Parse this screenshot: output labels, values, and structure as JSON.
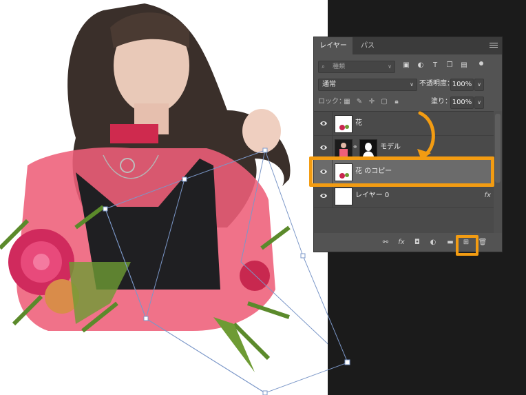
{
  "panel": {
    "tabs": [
      {
        "label": "レイヤー",
        "active": true
      },
      {
        "label": "パス",
        "active": false
      }
    ],
    "menu_icon": "hamburger-icon",
    "filter": {
      "placeholder": "種類",
      "icons": [
        "pixel-filter-icon",
        "adjustment-filter-icon",
        "type-filter-icon",
        "shape-filter-icon",
        "smart-object-filter-icon"
      ]
    },
    "blend_mode": "通常",
    "opacity_label": "不透明度：",
    "opacity_value": "100%",
    "lock_label": "ロック：",
    "lock_icons": [
      "lock-transparent-icon",
      "lock-paint-icon",
      "lock-move-icon",
      "lock-artboard-icon",
      "lock-all-icon"
    ],
    "fill_label": "塗り：",
    "fill_value": "100%",
    "layers": [
      {
        "name": "花",
        "visible": true,
        "selected": false,
        "has_mask": false,
        "fx": ""
      },
      {
        "name": "モデル",
        "visible": true,
        "selected": false,
        "has_mask": true,
        "fx": ""
      },
      {
        "name": "花 のコピー",
        "visible": true,
        "selected": true,
        "has_mask": false,
        "fx": ""
      },
      {
        "name": "レイヤー 0",
        "visible": true,
        "selected": false,
        "has_mask": false,
        "fx": "fx"
      }
    ],
    "bottom_icons": [
      "link-layers-icon",
      "fx-icon",
      "add-mask-icon",
      "adjustment-layer-icon",
      "new-group-icon",
      "new-layer-icon",
      "delete-icon"
    ],
    "bottom_fx_label": "fx"
  },
  "colors": {
    "highlight": "#f39c12",
    "panel_bg": "#535353",
    "selected_row": "#6b6b6b"
  }
}
